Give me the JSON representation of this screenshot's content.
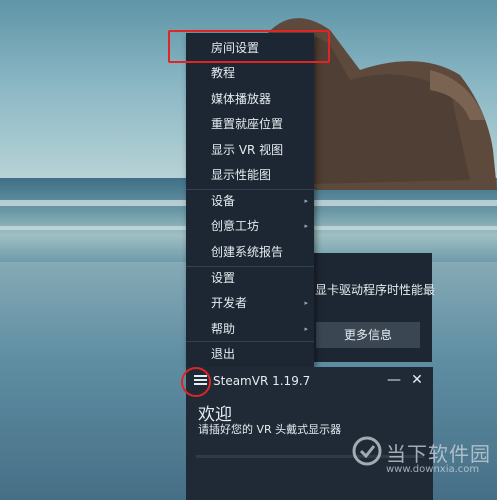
{
  "context_menu": {
    "items": [
      {
        "label": "房间设置",
        "submenu": false
      },
      {
        "label": "教程",
        "submenu": false
      },
      {
        "label": "媒体播放器",
        "submenu": false
      },
      {
        "label": "重置就座位置",
        "submenu": false
      },
      {
        "label": "显示 VR 视图",
        "submenu": false
      },
      {
        "label": "显示性能图",
        "submenu": false
      },
      {
        "label": "设备",
        "submenu": true
      },
      {
        "label": "创意工坊",
        "submenu": true
      },
      {
        "label": "创建系统报告",
        "submenu": false
      },
      {
        "label": "设置",
        "submenu": false
      },
      {
        "label": "开发者",
        "submenu": true
      },
      {
        "label": "帮助",
        "submenu": true
      },
      {
        "label": "退出",
        "submenu": false
      }
    ],
    "submenu_arrow": "▸",
    "highlight_color": "#e02525"
  },
  "notification": {
    "text": "显卡驱动程序时性能最",
    "button_label": "更多信息"
  },
  "steamvr_window": {
    "title": "SteamVR 1.19.7",
    "menu_icon": "hamburger-icon",
    "minimize_label": "—",
    "close_label": "✕",
    "welcome": "欢迎",
    "subtitle": "请插好您的 VR 头戴式显示器"
  },
  "watermark": {
    "name": "当下软件园",
    "url": "www.downxia.com"
  },
  "colors": {
    "menu_bg": "#1d2733",
    "text": "#e6ecf1",
    "annotation_red": "#e02525"
  }
}
